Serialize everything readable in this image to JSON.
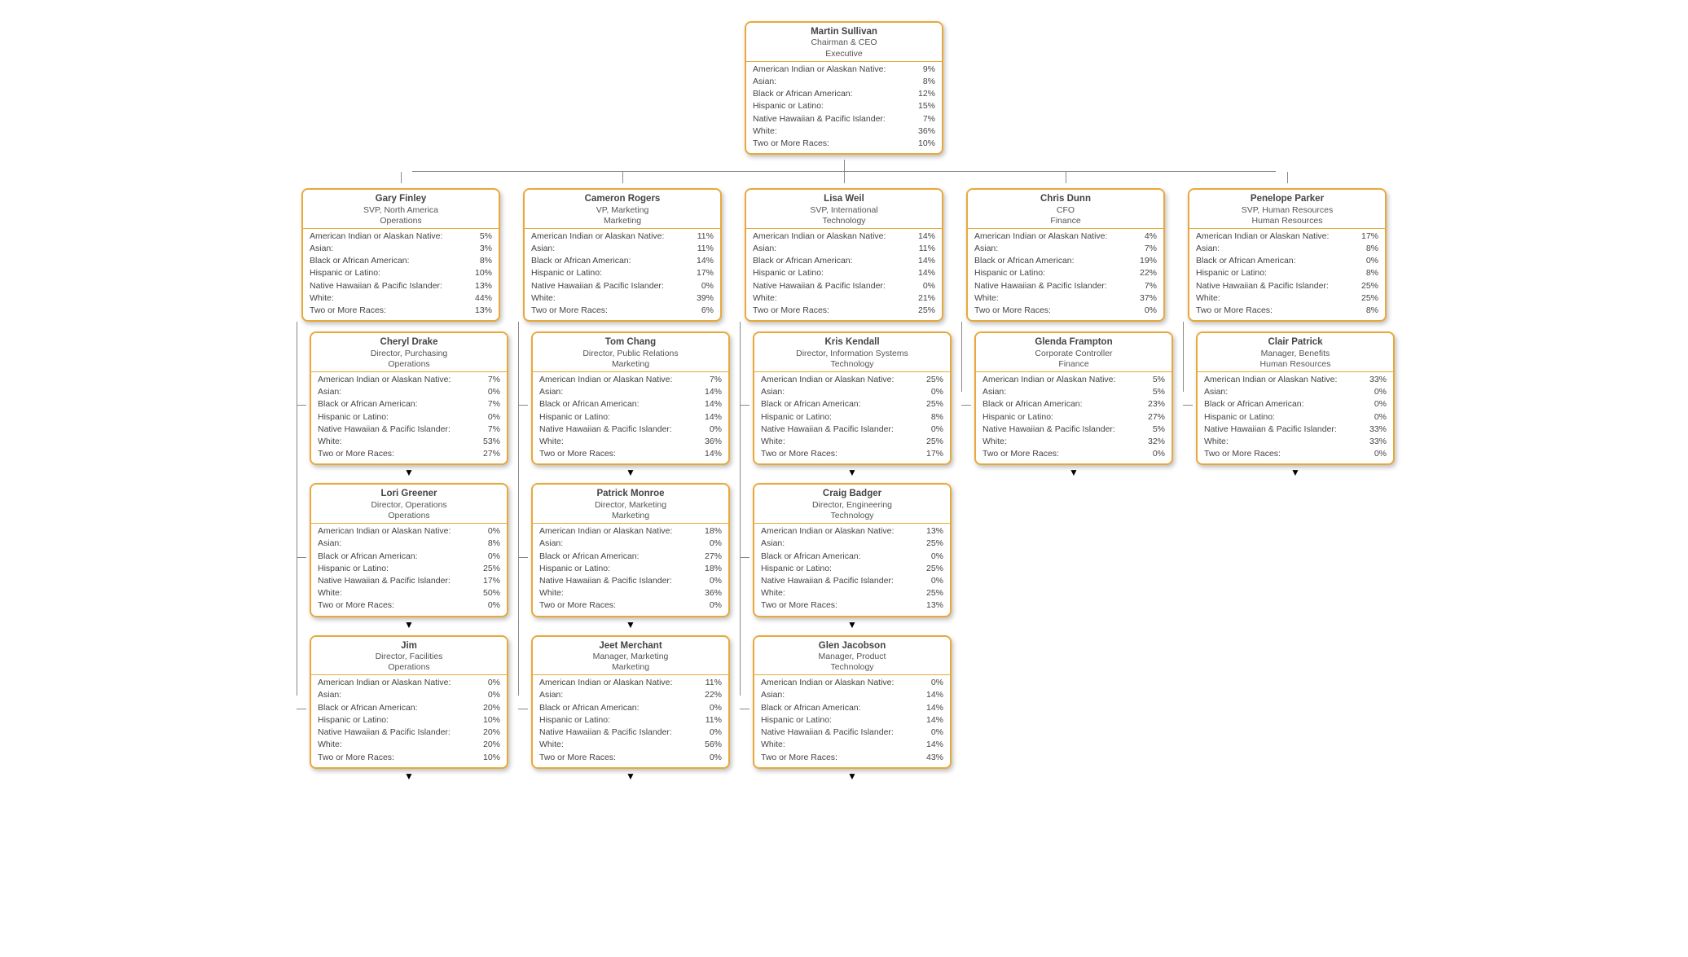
{
  "dem_labels": [
    "American Indian or Alaskan Native:",
    "Asian:",
    "Black or African American:",
    "Hispanic or Latino:",
    "Native Hawaiian & Pacific Islander:",
    "White:",
    "Two or More Races:"
  ],
  "root": {
    "name": "Martin Sullivan",
    "title": "Chairman & CEO",
    "dept": "Executive",
    "values": [
      "9%",
      "8%",
      "12%",
      "15%",
      "7%",
      "36%",
      "10%"
    ]
  },
  "columns": [
    {
      "head": {
        "name": "Gary Finley",
        "title": "SVP, North America",
        "dept": "Operations",
        "values": [
          "5%",
          "3%",
          "8%",
          "10%",
          "13%",
          "44%",
          "13%"
        ]
      },
      "subs": [
        {
          "name": "Cheryl Drake",
          "title": "Director, Purchasing",
          "dept": "Operations",
          "values": [
            "7%",
            "0%",
            "7%",
            "0%",
            "7%",
            "53%",
            "27%"
          ]
        },
        {
          "name": "Lori Greener",
          "title": "Director, Operations",
          "dept": "Operations",
          "values": [
            "0%",
            "8%",
            "0%",
            "25%",
            "17%",
            "50%",
            "0%"
          ]
        },
        {
          "name": "Jim",
          "title": "Director, Facilities",
          "dept": "Operations",
          "values": [
            "0%",
            "0%",
            "20%",
            "10%",
            "20%",
            "20%",
            "10%"
          ]
        }
      ]
    },
    {
      "head": {
        "name": "Cameron Rogers",
        "title": "VP, Marketing",
        "dept": "Marketing",
        "values": [
          "11%",
          "11%",
          "14%",
          "17%",
          "0%",
          "39%",
          "6%"
        ]
      },
      "subs": [
        {
          "name": "Tom Chang",
          "title": "Director, Public Relations",
          "dept": "Marketing",
          "values": [
            "7%",
            "14%",
            "14%",
            "14%",
            "0%",
            "36%",
            "14%"
          ]
        },
        {
          "name": "Patrick Monroe",
          "title": "Director, Marketing",
          "dept": "Marketing",
          "values": [
            "18%",
            "0%",
            "27%",
            "18%",
            "0%",
            "36%",
            "0%"
          ]
        },
        {
          "name": "Jeet Merchant",
          "title": "Manager, Marketing",
          "dept": "Marketing",
          "values": [
            "11%",
            "22%",
            "0%",
            "11%",
            "0%",
            "56%",
            "0%"
          ]
        }
      ]
    },
    {
      "head": {
        "name": "Lisa Weil",
        "title": "SVP, International",
        "dept": "Technology",
        "values": [
          "14%",
          "11%",
          "14%",
          "14%",
          "0%",
          "21%",
          "25%"
        ]
      },
      "subs": [
        {
          "name": "Kris Kendall",
          "title": "Director, Information Systems",
          "dept": "Technology",
          "values": [
            "25%",
            "0%",
            "25%",
            "8%",
            "0%",
            "25%",
            "17%"
          ]
        },
        {
          "name": "Craig Badger",
          "title": "Director, Engineering",
          "dept": "Technology",
          "values": [
            "13%",
            "25%",
            "0%",
            "25%",
            "0%",
            "25%",
            "13%"
          ]
        },
        {
          "name": "Glen Jacobson",
          "title": "Manager, Product",
          "dept": "Technology",
          "values": [
            "0%",
            "14%",
            "14%",
            "14%",
            "0%",
            "14%",
            "43%"
          ]
        }
      ]
    },
    {
      "head": {
        "name": "Chris Dunn",
        "title": "CFO",
        "dept": "Finance",
        "values": [
          "4%",
          "7%",
          "19%",
          "22%",
          "7%",
          "37%",
          "0%"
        ]
      },
      "subs": [
        {
          "name": "Glenda Frampton",
          "title": "Corporate Controller",
          "dept": "Finance",
          "values": [
            "5%",
            "5%",
            "23%",
            "27%",
            "5%",
            "32%",
            "0%"
          ]
        }
      ]
    },
    {
      "head": {
        "name": "Penelope Parker",
        "title": "SVP, Human Resources",
        "dept": "Human Resources",
        "values": [
          "17%",
          "8%",
          "0%",
          "8%",
          "25%",
          "25%",
          "8%"
        ]
      },
      "subs": [
        {
          "name": "Clair Patrick",
          "title": "Manager, Benefits",
          "dept": "Human Resources",
          "values": [
            "33%",
            "0%",
            "0%",
            "0%",
            "33%",
            "33%",
            "0%"
          ]
        }
      ]
    }
  ]
}
